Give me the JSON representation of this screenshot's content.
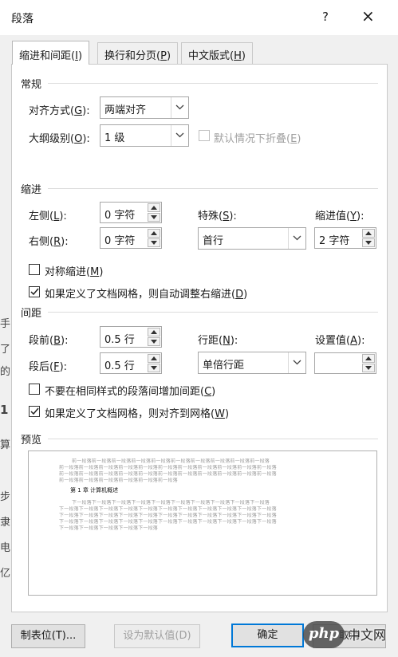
{
  "dialog": {
    "title": "段落",
    "help": "?",
    "close": "×"
  },
  "tabs": [
    {
      "label": "缩进和间距",
      "key": "I"
    },
    {
      "label": "换行和分页",
      "key": "P"
    },
    {
      "label": "中文版式",
      "key": "H"
    }
  ],
  "general": {
    "title": "常规",
    "alignment": {
      "label": "对齐方式",
      "key": "G",
      "value": "两端对齐"
    },
    "outline": {
      "label": "大纲级别",
      "key": "O",
      "value": "1 级"
    },
    "collapse": {
      "label": "默认情况下折叠",
      "key": "E",
      "checked": false
    }
  },
  "indent": {
    "title": "缩进",
    "left": {
      "label": "左侧",
      "key": "L",
      "value": "0 字符"
    },
    "right": {
      "label": "右侧",
      "key": "R",
      "value": "0 字符"
    },
    "special": {
      "label": "特殊",
      "key": "S",
      "value": "首行"
    },
    "by": {
      "label": "缩进值",
      "key": "Y",
      "value": "2 字符"
    },
    "mirror": {
      "label": "对称缩进",
      "key": "M",
      "checked": false
    },
    "auto_adjust": {
      "label": "如果定义了文档网格，则自动调整右缩进",
      "key": "D",
      "checked": true
    }
  },
  "spacing": {
    "title": "间距",
    "before": {
      "label": "段前",
      "key": "B",
      "value": "0.5 行"
    },
    "after": {
      "label": "段后",
      "key": "F",
      "value": "0.5 行"
    },
    "line": {
      "label": "行距",
      "key": "N",
      "value": "单倍行距"
    },
    "at": {
      "label": "设置值",
      "key": "A",
      "value": ""
    },
    "no_space_same": {
      "label": "不要在相同样式的段落间增加间距",
      "key": "C",
      "checked": false
    },
    "snap_grid": {
      "label": "如果定义了文档网格，则对齐到网格",
      "key": "W",
      "checked": true
    }
  },
  "preview": {
    "title": "预览",
    "prev_lines": [
      "前一段落前一段落前一段落前一段落前一段落前一段落前一段落前一段落前一段落前一段落",
      "前一段落前一段落前一段落前一段落前一段落前一段落前一段落前一段落前一段落前一段落前一段落",
      "前一段落前一段落前一段落前一段落前一段落前一段落前一段落前一段落前一段落前一段落前一段落",
      "前一段落前一段落前一段落前一段落前一段落前一段落"
    ],
    "sample": "第 1 章   计算机概述",
    "next_lines": [
      "下一段落下一段落下一段落下一段落下一段落下一段落下一段落下一段落下一段落下一段落",
      "下一段落下一段落下一段落下一段落下一段落下一段落下一段落下一段落下一段落下一段落下一段落",
      "下一段落下一段落下一段落下一段落下一段落下一段落下一段落下一段落下一段落下一段落下一段落",
      "下一段落下一段落下一段落下一段落下一段落下一段落下一段落下一段落下一段落下一段落下一段落",
      "下一段落下一段落下一段落下一段落下一段落"
    ]
  },
  "buttons": {
    "tabs": "制表位(T)...",
    "set_default": "设为默认值(D)",
    "ok": "确定",
    "cancel": "取消"
  },
  "overlay": {
    "watermark": "php",
    "site": "中文网"
  }
}
